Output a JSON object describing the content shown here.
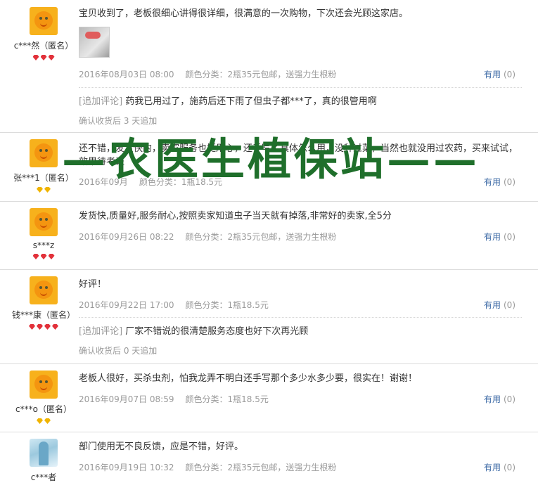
{
  "reviews": [
    {
      "user": "c***然（匿名）",
      "text": "宝贝收到了，老板很细心讲得很详细，很满意的一次购物，下次还会光顾这家店。",
      "date": "2016年08月03日 08:00",
      "spec": "颜色分类：2瓶35元包邮，送强力生根粉",
      "useful_label": "有用",
      "useful_count": "(0)",
      "append_tag": "[追加评论]",
      "append_text": "药我已用过了，施药后还下雨了但虫子都***了，真的很管用啊",
      "append_after": "确认收货后 3 天追加"
    },
    {
      "user": "张***1（匿名）",
      "text": "还不错，发货快的，卖家服务也挺用心，还手写了具体怎么用，没种过菜，当然也就没用过农药，买来试试，效果待考证",
      "date": "2016年09月",
      "spec": "颜色分类：1瓶18.5元",
      "useful_label": "有用",
      "useful_count": "(0)"
    },
    {
      "user": "s***z",
      "text": "发货快,质量好,服务耐心,按照卖家知道虫子当天就有掉落,非常好的卖家,全5分",
      "date": "2016年09月26日 08:22",
      "spec": "颜色分类：2瓶35元包邮，送强力生根粉",
      "useful_label": "有用",
      "useful_count": "(0)"
    },
    {
      "user": "钱***康（匿名）",
      "text": "好评！",
      "date": "2016年09月22日 17:00",
      "spec": "颜色分类：1瓶18.5元",
      "useful_label": "有用",
      "useful_count": "(0)",
      "append_tag": "[追加评论]",
      "append_text": "厂家不错说的很清楚服务态度也好下次再光顾",
      "append_after": "确认收货后 0 天追加"
    },
    {
      "user": "c***o（匿名）",
      "text": "老板人很好，买杀虫剂，怕我龙弄不明白还手写那个多少水多少要，很实在！谢谢！",
      "date": "2016年09月07日 08:59",
      "spec": "颜色分类：1瓶18.5元",
      "useful_label": "有用",
      "useful_count": "(0)"
    },
    {
      "user": "c***者",
      "text": "部门使用无不良反馈，应是不错，好评。",
      "date": "2016年09月19日 10:32",
      "spec": "颜色分类：2瓶35元包邮，送强力生根粉",
      "useful_label": "有用",
      "useful_count": "(0)"
    }
  ],
  "watermark": "—农医生植保站——",
  "colors": {
    "gem_red": "#e2313a",
    "gem_gold": "#f0b400",
    "link": "#3d6aa6",
    "watermark": "#1f6f2b"
  },
  "icons": {
    "avatar": "orange-mascot-avatar",
    "photo_avatar": "photo-avatar",
    "gem": "gem-icon"
  }
}
